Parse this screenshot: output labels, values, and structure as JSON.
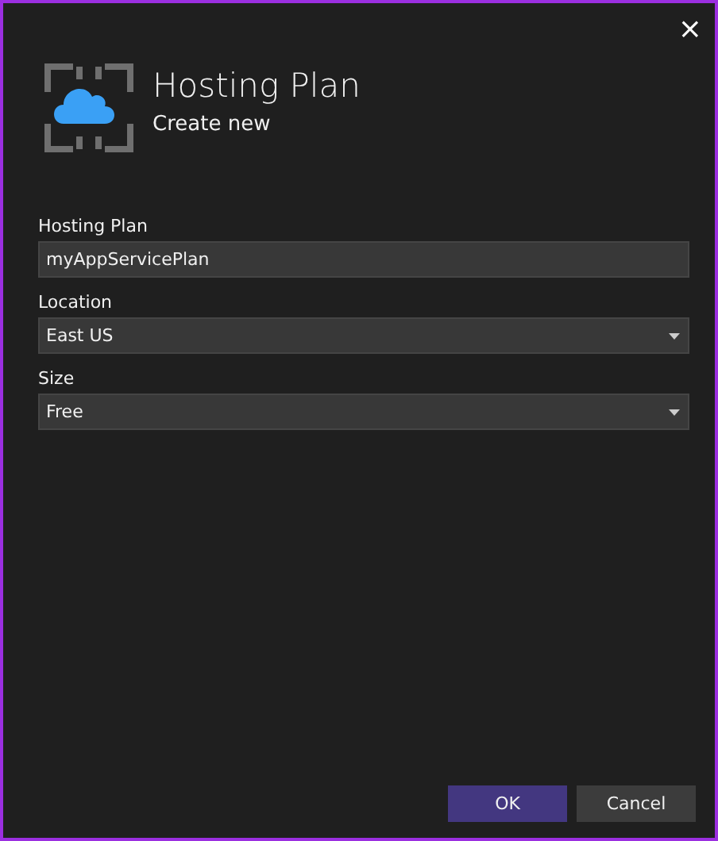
{
  "close_button": "×",
  "header": {
    "title": "Hosting Plan",
    "subtitle": "Create new"
  },
  "fields": [
    {
      "kind": "text",
      "label": "Hosting Plan",
      "value": "myAppServicePlan"
    },
    {
      "kind": "dropdown",
      "label": "Location",
      "value": "East US"
    },
    {
      "kind": "dropdown",
      "label": "Size",
      "value": "Free"
    }
  ],
  "buttons": [
    {
      "kind": "primary",
      "label": "OK"
    },
    {
      "kind": "secondary",
      "label": "Cancel"
    }
  ]
}
